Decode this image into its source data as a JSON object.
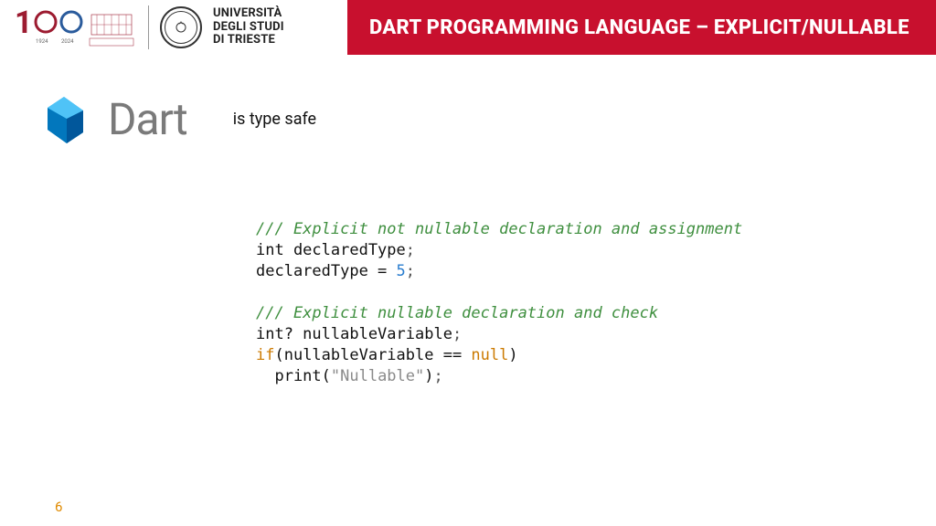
{
  "header": {
    "anniversary_years": {
      "from": "1924",
      "to": "2024"
    },
    "university": {
      "line1": "UNIVERSITÀ",
      "line2": "DEGLI STUDI",
      "line3": "DI TRIESTE"
    },
    "title": "DART PROGRAMMING LANGUAGE – EXPLICIT/NULLABLE"
  },
  "brand": {
    "name": "Dart",
    "tagline": "is type safe"
  },
  "code": {
    "comment1": "/// Explicit not nullable declaration and assignment",
    "line_decl_type": "int declaredType",
    "semi": ";",
    "line_assign_lhs": "declaredType = ",
    "line_assign_num": "5",
    "comment2": "/// Explicit nullable declaration and check",
    "line_nullable_decl": "int? nullableVariable",
    "kw_if": "if",
    "cond_open": "(nullableVariable == ",
    "kw_null": "null",
    "cond_close": ")",
    "print_open": "  print(",
    "str_nullable": "\"Nullable\"",
    "print_close": ")"
  },
  "page_number": "6"
}
